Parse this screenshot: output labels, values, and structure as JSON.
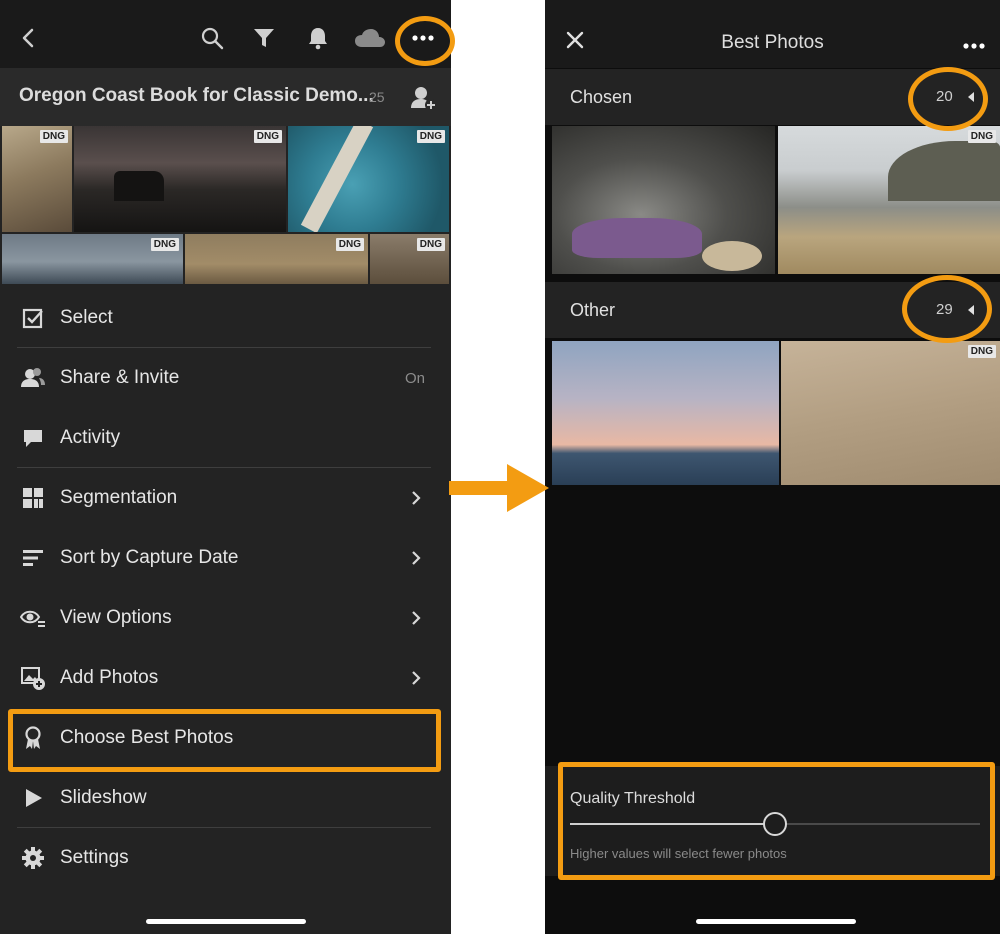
{
  "left_phone": {
    "album": {
      "title": "Oregon Coast Book for Classic Demo...",
      "count": "25"
    },
    "badge": "DNG",
    "menu": [
      {
        "label": "Select",
        "icon": "checkbox-icon"
      },
      {
        "label": "Share & Invite",
        "icon": "people-icon",
        "value": "On"
      },
      {
        "label": "Activity",
        "icon": "comment-icon"
      },
      {
        "label": "Segmentation",
        "icon": "segmentation-icon",
        "chevron": true
      },
      {
        "label": "Sort by Capture Date",
        "icon": "sort-icon",
        "chevron": true
      },
      {
        "label": "View Options",
        "icon": "eye-icon",
        "chevron": true
      },
      {
        "label": "Add Photos",
        "icon": "add-photo-icon",
        "chevron": true
      },
      {
        "label": "Choose Best Photos",
        "icon": "award-icon",
        "highlighted": true
      },
      {
        "label": "Slideshow",
        "icon": "play-icon"
      },
      {
        "label": "Settings",
        "icon": "gear-icon"
      }
    ]
  },
  "right_phone": {
    "title": "Best Photos",
    "badge": "DNG",
    "chosen": {
      "label": "Chosen",
      "count": "20"
    },
    "other": {
      "label": "Other",
      "count": "29"
    },
    "quality": {
      "title": "Quality Threshold",
      "hint": "Higher values will select fewer photos",
      "value": 0.5
    }
  },
  "colors": {
    "accent": "#f39c12",
    "panel": "#232323",
    "background": "#0d0d0d"
  }
}
